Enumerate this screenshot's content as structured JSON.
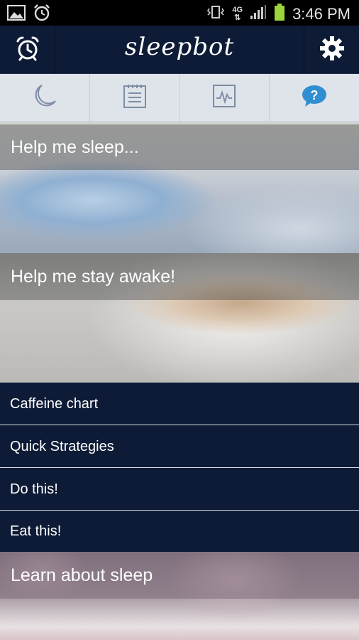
{
  "status_bar": {
    "time": "3:46 PM",
    "network": "4G",
    "icons": [
      "image-icon",
      "alarm-icon",
      "vibrate-icon",
      "signal-icon",
      "battery-icon"
    ]
  },
  "header": {
    "logo_text": "sleepbot",
    "left_icon": "alarm-clock-icon",
    "right_icon": "gear-icon"
  },
  "tabs": [
    {
      "icon": "moon-icon",
      "active": false
    },
    {
      "icon": "log-icon",
      "active": false
    },
    {
      "icon": "chart-icon",
      "active": false
    },
    {
      "icon": "help-icon",
      "active": true
    }
  ],
  "colors": {
    "accent": "#2f8fd0",
    "navy": "#0d1b36",
    "tab_bg": "#dfe3ea"
  },
  "sections": {
    "help_sleep": "Help me sleep...",
    "help_awake": "Help me stay awake!",
    "learn": "Learn about sleep"
  },
  "awake_items": [
    "Caffeine chart",
    "Quick Strategies",
    "Do this!",
    "Eat this!"
  ]
}
